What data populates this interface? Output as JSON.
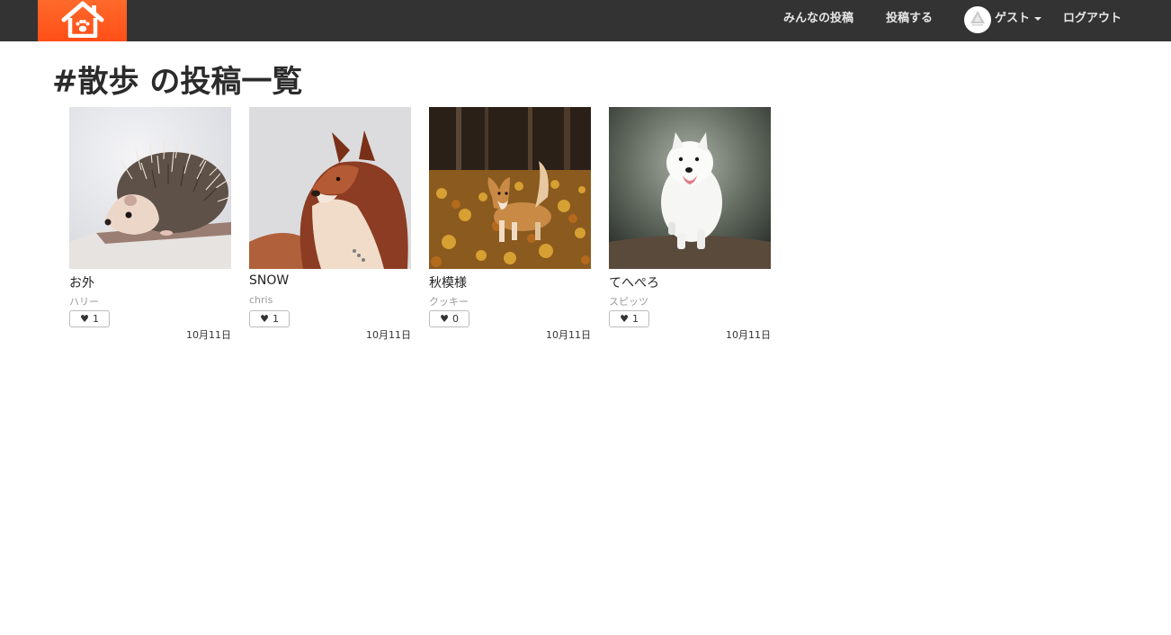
{
  "nav": {
    "logo_icon": "house-paw-icon",
    "all_posts": "みんなの投稿",
    "post": "投稿する",
    "user_name": "ゲスト",
    "logout": "ログアウト"
  },
  "page": {
    "title": "#散歩 の投稿一覧"
  },
  "posts": [
    {
      "title": "お外",
      "author": "ハリー",
      "likes": "1",
      "date": "10月11日",
      "image": "hedgehog"
    },
    {
      "title": "SNOW",
      "author": "chris",
      "likes": "1",
      "date": "10月11日",
      "image": "husky"
    },
    {
      "title": "秋模様",
      "author": "クッキー",
      "likes": "0",
      "date": "10月11日",
      "image": "corgi"
    },
    {
      "title": "てへぺろ",
      "author": "スピッツ",
      "likes": "1",
      "date": "10月11日",
      "image": "samoyed"
    }
  ],
  "colors": {
    "navbar": "#333333",
    "logo_bg": "#ff5a1f"
  }
}
